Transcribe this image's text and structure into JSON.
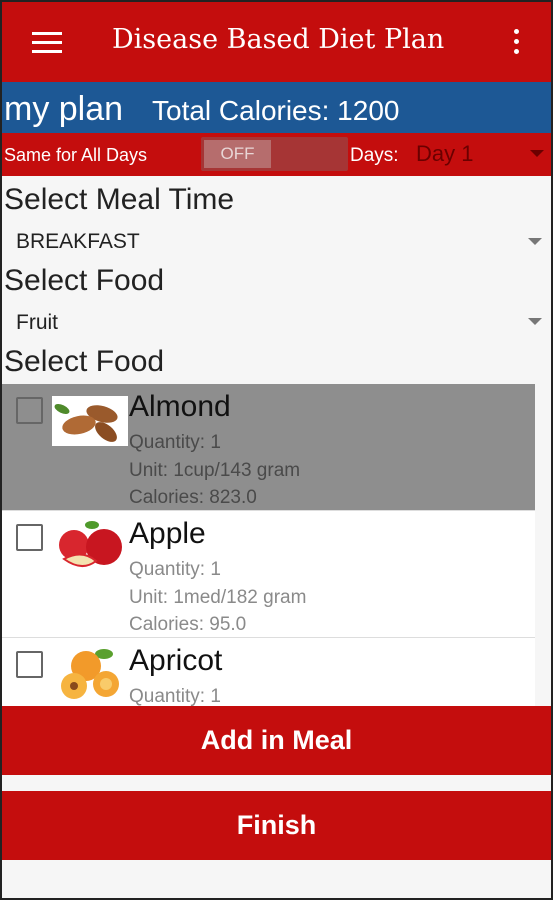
{
  "appbar": {
    "title": "Disease Based Diet Plan",
    "menu_icon": "hamburger-menu-icon",
    "more_icon": "more-vert-icon"
  },
  "plan": {
    "name": "my plan",
    "total_calories": "Total Calories: 1200"
  },
  "days": {
    "same_label": "Same for All Days",
    "toggle": "OFF",
    "days_label": "Days:",
    "selected_day": "Day 1"
  },
  "meal_time": {
    "label": "Select Meal Time",
    "value": "BREAKFAST"
  },
  "food_category": {
    "label": "Select Food",
    "value": "Fruit"
  },
  "food_list": {
    "label": "Select Food",
    "items": [
      {
        "name": "Almond",
        "quantity": "Quantity: 1",
        "unit": "Unit: 1cup/143 gram",
        "calories": "Calories: 823.0",
        "selected": true
      },
      {
        "name": "Apple",
        "quantity": "Quantity: 1",
        "unit": "Unit: 1med/182 gram",
        "calories": "Calories: 95.0",
        "selected": false
      },
      {
        "name": "Apricot",
        "quantity": "Quantity: 1",
        "selected": false
      }
    ]
  },
  "actions": {
    "add_label": "Add in Meal",
    "finish_label": "Finish"
  },
  "colors": {
    "primary_red": "#c40d0d",
    "plan_blue": "#1d5895",
    "selected_gray": "#8e8e8e"
  }
}
